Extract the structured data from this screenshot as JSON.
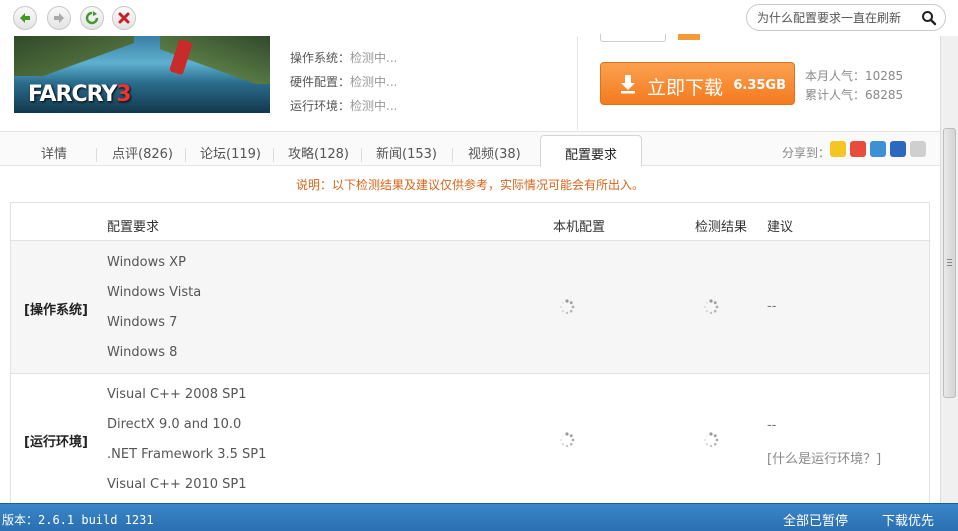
{
  "toolbar": {
    "back_icon": "back-arrow-icon",
    "forward_icon": "forward-arrow-icon",
    "refresh_icon": "refresh-icon",
    "stop_icon": "close-icon",
    "search_placeholder": "为什么配置要求一直在刷新"
  },
  "game": {
    "cover_logo": "FARCRY",
    "cover_logo_num": "3",
    "info": [
      {
        "label": "操作系统：",
        "value": "检测中..."
      },
      {
        "label": "硬件配置：",
        "value": "检测中..."
      },
      {
        "label": "运行环境：",
        "value": "检测中..."
      }
    ],
    "download_label": "立即下载",
    "download_size": "6.35GB",
    "monthly_label": "本月人气：",
    "monthly_value": "10285",
    "total_label": "累计人气：",
    "total_value": "68285"
  },
  "tabs": [
    {
      "label": "详情"
    },
    {
      "label": "点评(826)"
    },
    {
      "label": "论坛(119)"
    },
    {
      "label": "攻略(128)"
    },
    {
      "label": "新闻(153)"
    },
    {
      "label": "视频(38)"
    },
    {
      "label": "配置要求"
    }
  ],
  "share_label": "分享到：",
  "notice": "说明：以下检测结果及建议仅供参考，实际情况可能会有所出入。",
  "table": {
    "headers": {
      "req": "配置要求",
      "local": "本机配置",
      "result": "检测结果",
      "advice": "建议"
    },
    "rows": [
      {
        "category": "[操作系统]",
        "items": [
          "Windows XP",
          "Windows Vista",
          "Windows 7",
          "Windows 8"
        ],
        "advice": "--"
      },
      {
        "category": "[运行环境]",
        "items": [
          "Visual C++ 2008 SP1",
          "DirectX 9.0 and 10.0",
          ".NET Framework 3.5 SP1",
          "Visual C++ 2010 SP1"
        ],
        "advice": "--",
        "advice_link": "[什么是运行环境？]"
      }
    ]
  },
  "statusbar": {
    "version": "版本：2.6.1 build 1231",
    "pause_all": "全部已暂停",
    "download_first": "下载优先"
  },
  "colors": {
    "download_button": "#f47a1f",
    "notice_text": "#d8641a",
    "statusbar": "#2a6fb1"
  }
}
